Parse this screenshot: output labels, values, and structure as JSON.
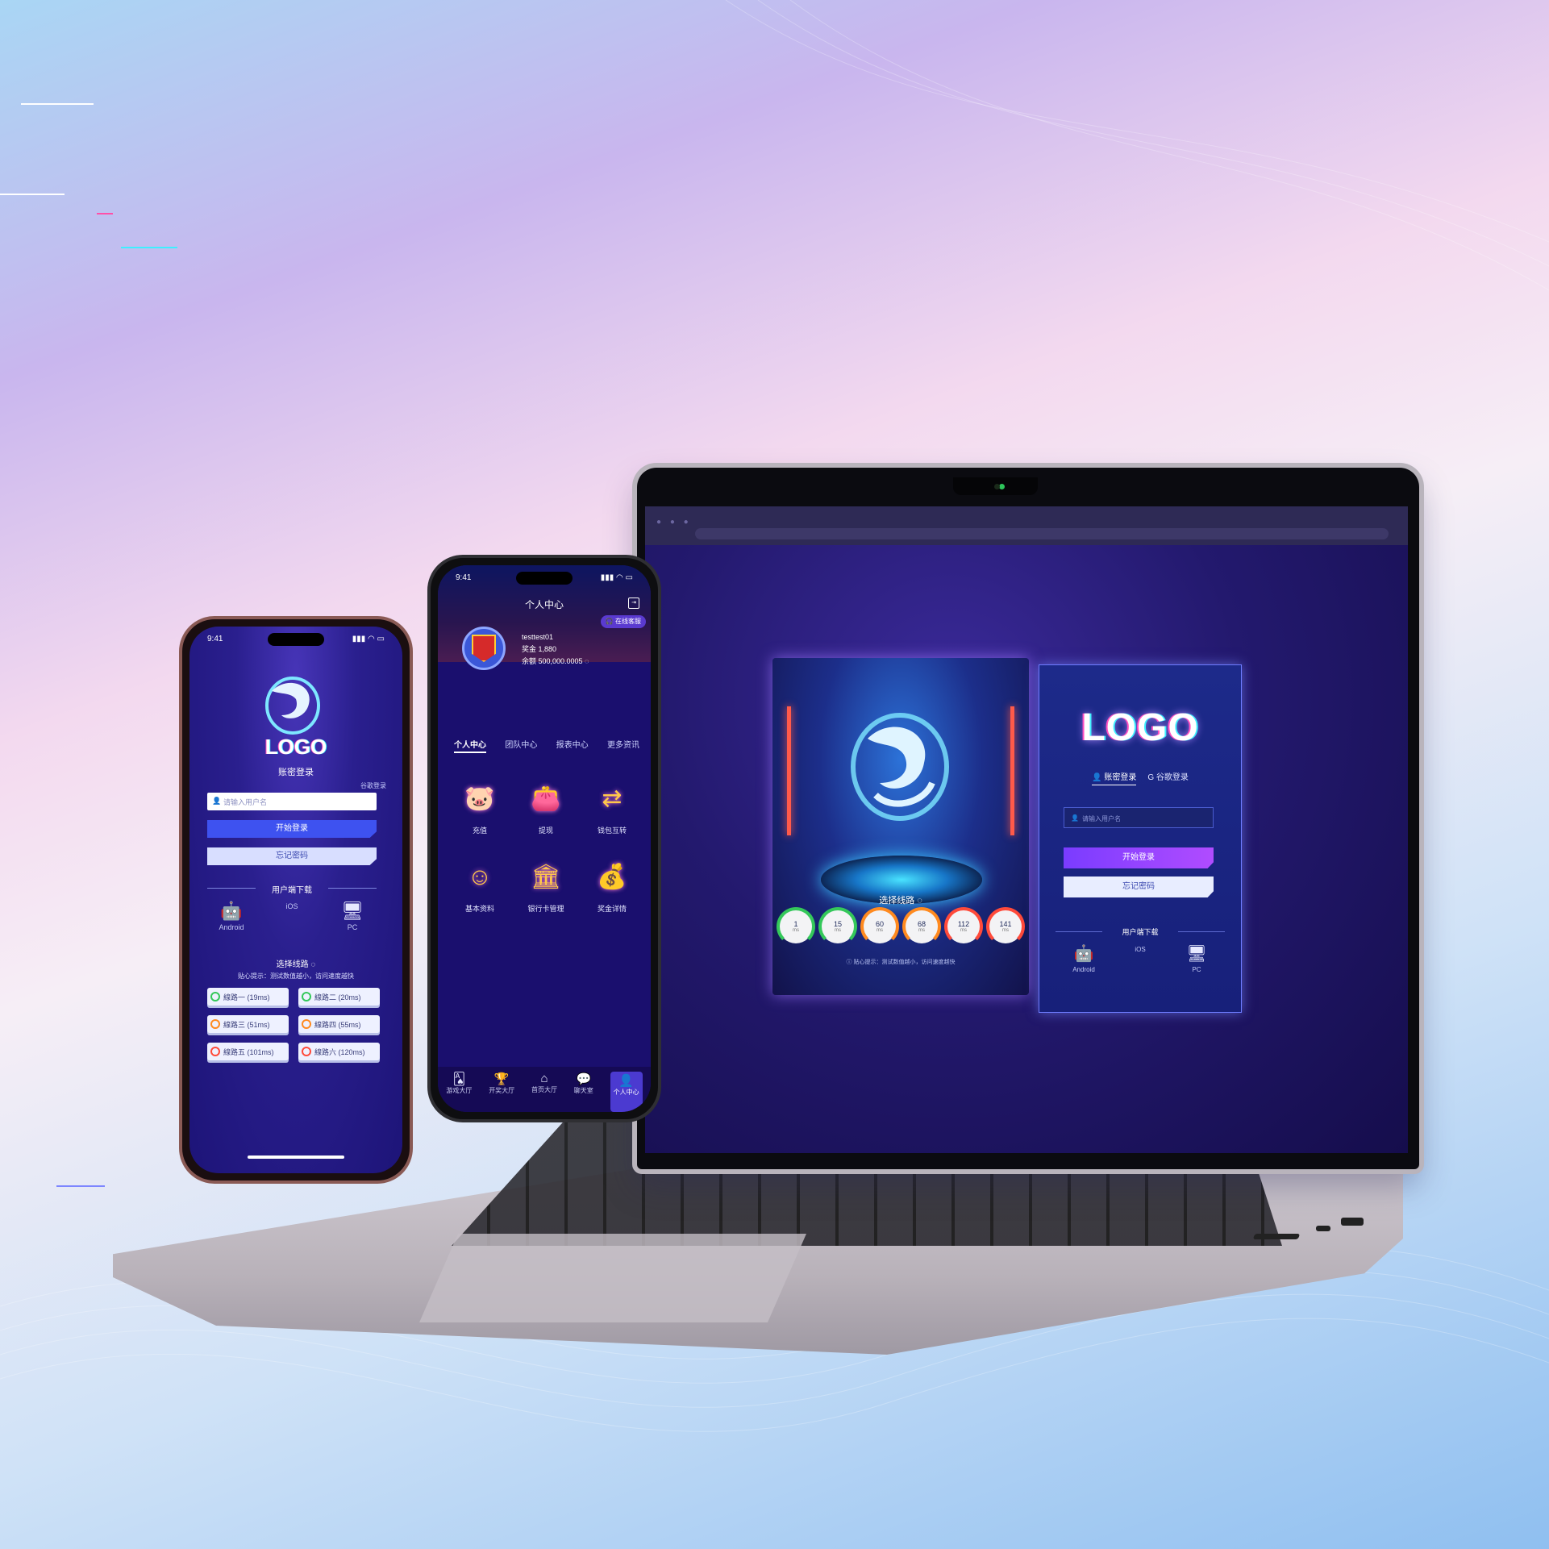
{
  "colors": {
    "accent": "#3e52f0",
    "primary_button": "#8a44ff",
    "gauge_green": "#34c85a",
    "gauge_orange": "#ff8a1f",
    "gauge_red": "#ff4a3a"
  },
  "laptop": {
    "logo": "LOGO",
    "tabs": [
      {
        "label": "账密登录",
        "active": true,
        "icon": "user-icon"
      },
      {
        "label": "谷歌登录",
        "active": false,
        "icon": "google-icon"
      }
    ],
    "username_placeholder": "请输入用户名",
    "login_button": "开始登录",
    "forgot_button": "忘记密码",
    "download_title": "用户端下载",
    "downloads": [
      {
        "label": "Android",
        "icon": "android-icon"
      },
      {
        "label": "iOS",
        "icon": "apple-icon"
      },
      {
        "label": "PC",
        "icon": "monitor-icon"
      }
    ],
    "route_title": "选择线路 ◌",
    "gauges": [
      {
        "value": "1",
        "unit": "ms",
        "color": "#34c85a"
      },
      {
        "value": "15",
        "unit": "ms",
        "color": "#34c85a"
      },
      {
        "value": "60",
        "unit": "ms",
        "color": "#ff8a1f"
      },
      {
        "value": "68",
        "unit": "ms",
        "color": "#ff8a1f"
      },
      {
        "value": "112",
        "unit": "ms",
        "color": "#ff4a3a"
      },
      {
        "value": "141",
        "unit": "ms",
        "color": "#ff4a3a"
      }
    ],
    "hint": "ⓘ 贴心提示：测试数值越小，访问速度越快"
  },
  "phone_login": {
    "time": "9:41",
    "logo": "LOGO",
    "subtitle": "账密登录",
    "alt_login": "谷歌登录",
    "username_placeholder": "请输入用户名",
    "login_button": "开始登录",
    "forgot_button": "忘记密码",
    "download_title": "用户端下载",
    "downloads": [
      {
        "label": "Android",
        "icon": "android-icon"
      },
      {
        "label": "iOS",
        "icon": "apple-icon"
      },
      {
        "label": "PC",
        "icon": "monitor-icon"
      }
    ],
    "route_title": "选择线路 ◌",
    "hint": "贴心提示：测试数值越小，访问速度越快",
    "routes": [
      {
        "label": "線路一 (19ms)",
        "color": "#34c85a"
      },
      {
        "label": "線路二 (20ms)",
        "color": "#34c85a"
      },
      {
        "label": "線路三 (51ms)",
        "color": "#ff8a1f"
      },
      {
        "label": "線路四 (55ms)",
        "color": "#ff8a1f"
      },
      {
        "label": "線路五 (101ms)",
        "color": "#ff4a3a"
      },
      {
        "label": "線路六 (120ms)",
        "color": "#ff4a3a"
      }
    ]
  },
  "phone_center": {
    "time": "9:41",
    "title": "个人中心",
    "online_service": "在线客服",
    "username": "testtest01",
    "bonus": "奖金  1,880",
    "balance": "余额  500,000.0005 ◌",
    "tabs": [
      {
        "label": "个人中心",
        "active": true
      },
      {
        "label": "团队中心",
        "active": false
      },
      {
        "label": "报表中心",
        "active": false
      },
      {
        "label": "更多资讯",
        "active": false
      }
    ],
    "grid": [
      {
        "label": "充值",
        "icon": "piggy-bank-icon"
      },
      {
        "label": "提现",
        "icon": "wallet-icon"
      },
      {
        "label": "钱包互转",
        "icon": "transfer-icon"
      },
      {
        "label": "基本资料",
        "icon": "profile-icon"
      },
      {
        "label": "银行卡管理",
        "icon": "bank-icon"
      },
      {
        "label": "奖金详情",
        "icon": "money-bag-icon"
      }
    ],
    "nav": [
      {
        "label": "游戏大厅",
        "icon": "cards-icon"
      },
      {
        "label": "开奖大厅",
        "icon": "trophy-icon"
      },
      {
        "label": "首页大厅",
        "icon": "home-icon"
      },
      {
        "label": "聊天室",
        "icon": "chat-icon"
      },
      {
        "label": "个人中心",
        "icon": "user-icon",
        "active": true
      }
    ]
  }
}
